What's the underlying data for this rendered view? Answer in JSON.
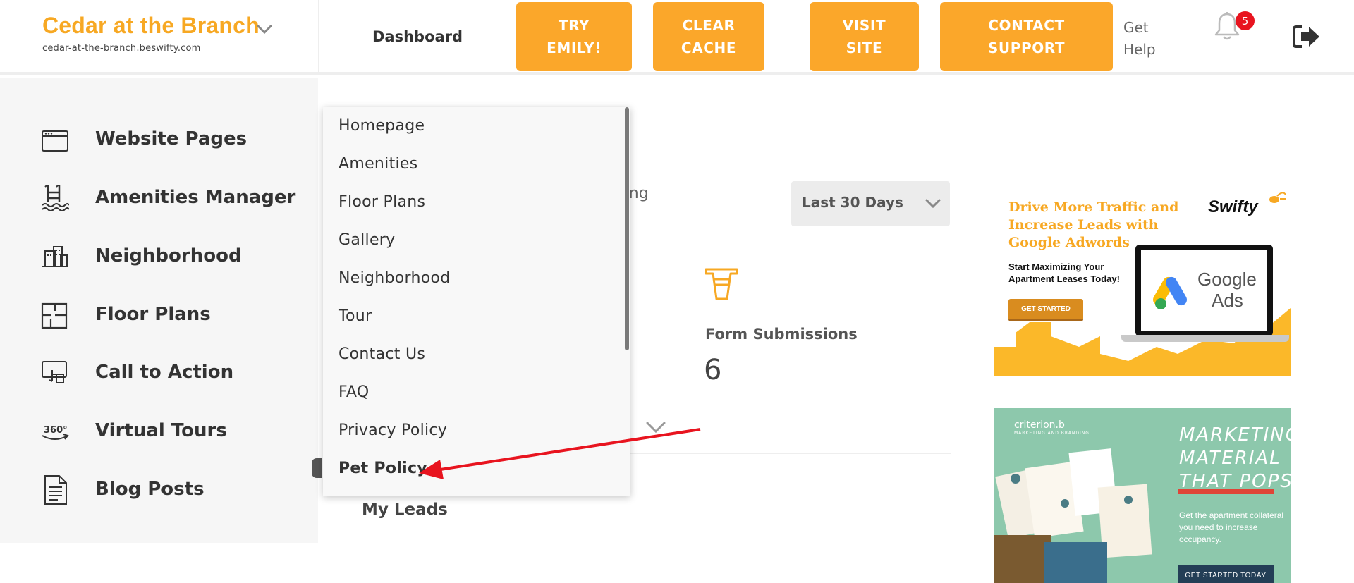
{
  "brand": {
    "name": "Cedar at the Branch",
    "url": "cedar-at-the-branch.beswifty.com"
  },
  "header": {
    "dashboard_label": "Dashboard",
    "buttons": [
      {
        "line1": "TRY",
        "line2": "EMILY!"
      },
      {
        "line1": "CLEAR",
        "line2": "CACHE"
      },
      {
        "line1": "VISIT",
        "line2": "SITE"
      },
      {
        "line1": "CONTACT",
        "line2": "SUPPORT"
      }
    ],
    "get_help": {
      "line1": "Get",
      "line2": "Help"
    },
    "notification_count": "5",
    "accent_color": "#fba72a",
    "badge_color": "#e8141f"
  },
  "sidebar": {
    "items": [
      {
        "label": "Website Pages",
        "icon": "browser-window-icon"
      },
      {
        "label": "Amenities Manager",
        "icon": "pool-ladder-icon"
      },
      {
        "label": "Neighborhood",
        "icon": "buildings-icon"
      },
      {
        "label": "Floor Plans",
        "icon": "floor-plan-icon"
      },
      {
        "label": "Call to Action",
        "icon": "touch-screen-icon"
      },
      {
        "label": "Virtual Tours",
        "icon": "360-view-icon"
      },
      {
        "label": "Blog Posts",
        "icon": "document-icon"
      }
    ]
  },
  "dropdown": {
    "items": [
      "Homepage",
      "Amenities",
      "Floor Plans",
      "Gallery",
      "Neighborhood",
      "Tour",
      "Contact Us",
      "FAQ",
      "Privacy Policy",
      "Pet Policy"
    ],
    "active": "Pet Policy"
  },
  "main": {
    "partial_text": "rting",
    "range_select": {
      "value": "Last 30 Days"
    },
    "stat": {
      "label": "Form Submissions",
      "value": "6",
      "icon": "funnel-icon"
    },
    "my_leads": "My Leads"
  },
  "ads": {
    "google": {
      "headline": "Drive More Traffic and Increase Leads with Google Adwords",
      "brand": "Swifty",
      "subtext": "Start Maximizing Your Apartment Leases Today!",
      "button": "GET STARTED",
      "screen_word1": "Google",
      "screen_word2": "Ads"
    },
    "criterion": {
      "logo": "criterion.b",
      "logo_sub": "MARKETING AND BRANDING",
      "headline_lines": [
        "MARKETING",
        "MATERIAL",
        "THAT POPS"
      ],
      "subtext": "Get the apartment collateral you need to increase occupancy.",
      "button": "GET STARTED TODAY"
    }
  }
}
